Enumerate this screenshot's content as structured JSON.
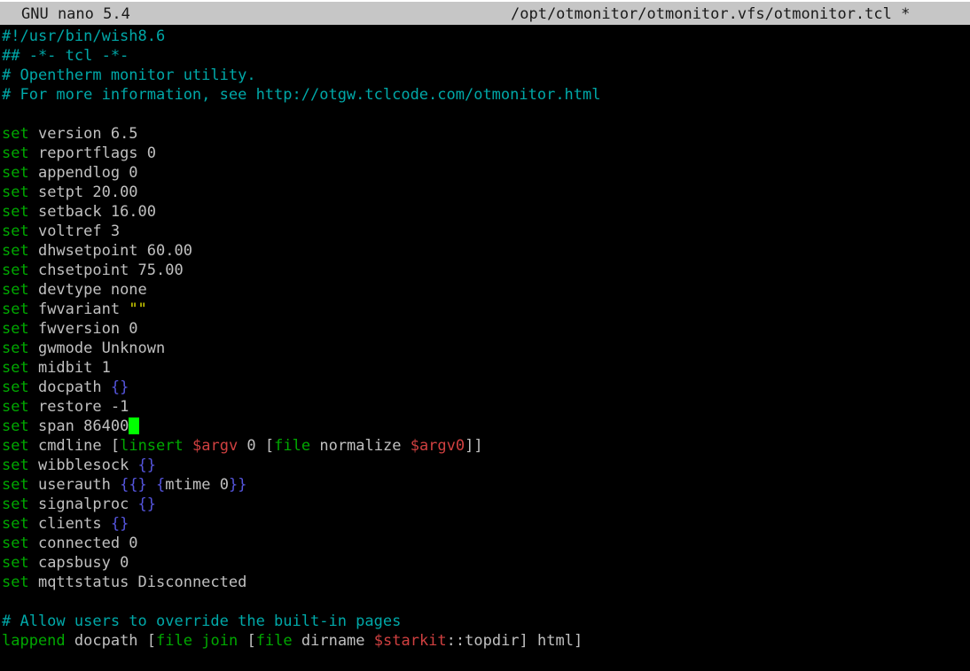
{
  "titlebar": {
    "app": "GNU nano 5.4",
    "filename": "/opt/otmonitor/otmonitor.vfs/otmonitor.tcl",
    "modified_indicator": "*"
  },
  "colors": {
    "background": "#000000",
    "titlebar_background": "#c6c6c6",
    "titlebar_text": "#1a1a1a",
    "default_text": "#c0c0c0",
    "comment": "#00a8a8",
    "keyword": "#00a800",
    "brace": "#5555dd",
    "string": "#d7d700",
    "variable": "#d04040",
    "cursor": "#00ff00"
  },
  "cursor": {
    "line": 22,
    "column": 15,
    "glyph_block": " "
  },
  "editor": {
    "lines": [
      {
        "id": 1,
        "tokens": [
          {
            "t": "#!/usr/bin/wish8.6",
            "c": "comment"
          }
        ]
      },
      {
        "id": 2,
        "tokens": [
          {
            "t": "## -*- tcl -*-",
            "c": "comment"
          }
        ]
      },
      {
        "id": 3,
        "tokens": [
          {
            "t": "# Opentherm monitor utility.",
            "c": "comment"
          }
        ]
      },
      {
        "id": 4,
        "tokens": [
          {
            "t": "# For more information, see http://otgw.tclcode.com/otmonitor.html",
            "c": "comment"
          }
        ]
      },
      {
        "id": 5,
        "tokens": []
      },
      {
        "id": 6,
        "tokens": [
          {
            "t": "set",
            "c": "keyword"
          },
          {
            "t": " version 6.5",
            "c": "plain"
          }
        ]
      },
      {
        "id": 7,
        "tokens": [
          {
            "t": "set",
            "c": "keyword"
          },
          {
            "t": " reportflags 0",
            "c": "plain"
          }
        ]
      },
      {
        "id": 8,
        "tokens": [
          {
            "t": "set",
            "c": "keyword"
          },
          {
            "t": " appendlog 0",
            "c": "plain"
          }
        ]
      },
      {
        "id": 9,
        "tokens": [
          {
            "t": "set",
            "c": "keyword"
          },
          {
            "t": " setpt 20.00",
            "c": "plain"
          }
        ]
      },
      {
        "id": 10,
        "tokens": [
          {
            "t": "set",
            "c": "keyword"
          },
          {
            "t": " setback 16.00",
            "c": "plain"
          }
        ]
      },
      {
        "id": 11,
        "tokens": [
          {
            "t": "set",
            "c": "keyword"
          },
          {
            "t": " voltref 3",
            "c": "plain"
          }
        ]
      },
      {
        "id": 12,
        "tokens": [
          {
            "t": "set",
            "c": "keyword"
          },
          {
            "t": " dhwsetpoint 60.00",
            "c": "plain"
          }
        ]
      },
      {
        "id": 13,
        "tokens": [
          {
            "t": "set",
            "c": "keyword"
          },
          {
            "t": " chsetpoint 75.00",
            "c": "plain"
          }
        ]
      },
      {
        "id": 14,
        "tokens": [
          {
            "t": "set",
            "c": "keyword"
          },
          {
            "t": " devtype none",
            "c": "plain"
          }
        ]
      },
      {
        "id": 15,
        "tokens": [
          {
            "t": "set",
            "c": "keyword"
          },
          {
            "t": " fwvariant ",
            "c": "plain"
          },
          {
            "t": "\"\"",
            "c": "string"
          }
        ]
      },
      {
        "id": 16,
        "tokens": [
          {
            "t": "set",
            "c": "keyword"
          },
          {
            "t": " fwversion 0",
            "c": "plain"
          }
        ]
      },
      {
        "id": 17,
        "tokens": [
          {
            "t": "set",
            "c": "keyword"
          },
          {
            "t": " gwmode Unknown",
            "c": "plain"
          }
        ]
      },
      {
        "id": 18,
        "tokens": [
          {
            "t": "set",
            "c": "keyword"
          },
          {
            "t": " midbit 1",
            "c": "plain"
          }
        ]
      },
      {
        "id": 19,
        "tokens": [
          {
            "t": "set",
            "c": "keyword"
          },
          {
            "t": " docpath ",
            "c": "plain"
          },
          {
            "t": "{}",
            "c": "brace"
          }
        ]
      },
      {
        "id": 20,
        "tokens": [
          {
            "t": "set",
            "c": "keyword"
          },
          {
            "t": " restore -1",
            "c": "plain"
          }
        ]
      },
      {
        "id": 21,
        "tokens": [
          {
            "t": "set",
            "c": "keyword"
          },
          {
            "t": " span 86400",
            "c": "plain"
          },
          {
            "t": "",
            "c": "cursor"
          }
        ]
      },
      {
        "id": 22,
        "tokens": [
          {
            "t": "set",
            "c": "keyword"
          },
          {
            "t": " cmdline ",
            "c": "plain"
          },
          {
            "t": "[",
            "c": "bracket"
          },
          {
            "t": "linsert",
            "c": "keyword"
          },
          {
            "t": " ",
            "c": "plain"
          },
          {
            "t": "$argv",
            "c": "var"
          },
          {
            "t": " 0 ",
            "c": "plain"
          },
          {
            "t": "[",
            "c": "bracket"
          },
          {
            "t": "file",
            "c": "keyword"
          },
          {
            "t": " normalize ",
            "c": "plain"
          },
          {
            "t": "$argv0",
            "c": "var"
          },
          {
            "t": "]]",
            "c": "bracket"
          }
        ]
      },
      {
        "id": 23,
        "tokens": [
          {
            "t": "set",
            "c": "keyword"
          },
          {
            "t": " wibblesock ",
            "c": "plain"
          },
          {
            "t": "{}",
            "c": "brace"
          }
        ]
      },
      {
        "id": 24,
        "tokens": [
          {
            "t": "set",
            "c": "keyword"
          },
          {
            "t": " userauth ",
            "c": "plain"
          },
          {
            "t": "{{}",
            "c": "brace"
          },
          {
            "t": " ",
            "c": "plain"
          },
          {
            "t": "{",
            "c": "brace"
          },
          {
            "t": "mtime 0",
            "c": "plain"
          },
          {
            "t": "}}",
            "c": "brace"
          }
        ]
      },
      {
        "id": 25,
        "tokens": [
          {
            "t": "set",
            "c": "keyword"
          },
          {
            "t": " signalproc ",
            "c": "plain"
          },
          {
            "t": "{}",
            "c": "brace"
          }
        ]
      },
      {
        "id": 26,
        "tokens": [
          {
            "t": "set",
            "c": "keyword"
          },
          {
            "t": " clients ",
            "c": "plain"
          },
          {
            "t": "{}",
            "c": "brace"
          }
        ]
      },
      {
        "id": 27,
        "tokens": [
          {
            "t": "set",
            "c": "keyword"
          },
          {
            "t": " connected 0",
            "c": "plain"
          }
        ]
      },
      {
        "id": 28,
        "tokens": [
          {
            "t": "set",
            "c": "keyword"
          },
          {
            "t": " capsbusy 0",
            "c": "plain"
          }
        ]
      },
      {
        "id": 29,
        "tokens": [
          {
            "t": "set",
            "c": "keyword"
          },
          {
            "t": " mqttstatus Disconnected",
            "c": "plain"
          }
        ]
      },
      {
        "id": 30,
        "tokens": []
      },
      {
        "id": 31,
        "tokens": [
          {
            "t": "# Allow users to override the built-in pages",
            "c": "comment"
          }
        ]
      },
      {
        "id": 32,
        "tokens": [
          {
            "t": "lappend",
            "c": "keyword"
          },
          {
            "t": " docpath ",
            "c": "plain"
          },
          {
            "t": "[",
            "c": "bracket"
          },
          {
            "t": "file",
            "c": "keyword"
          },
          {
            "t": " ",
            "c": "plain"
          },
          {
            "t": "join",
            "c": "keyword"
          },
          {
            "t": " ",
            "c": "plain"
          },
          {
            "t": "[",
            "c": "bracket"
          },
          {
            "t": "file",
            "c": "keyword"
          },
          {
            "t": " dirname ",
            "c": "plain"
          },
          {
            "t": "$starkit",
            "c": "var"
          },
          {
            "t": "::topdir",
            "c": "plain"
          },
          {
            "t": "] html]",
            "c": "bracket"
          }
        ]
      }
    ]
  }
}
